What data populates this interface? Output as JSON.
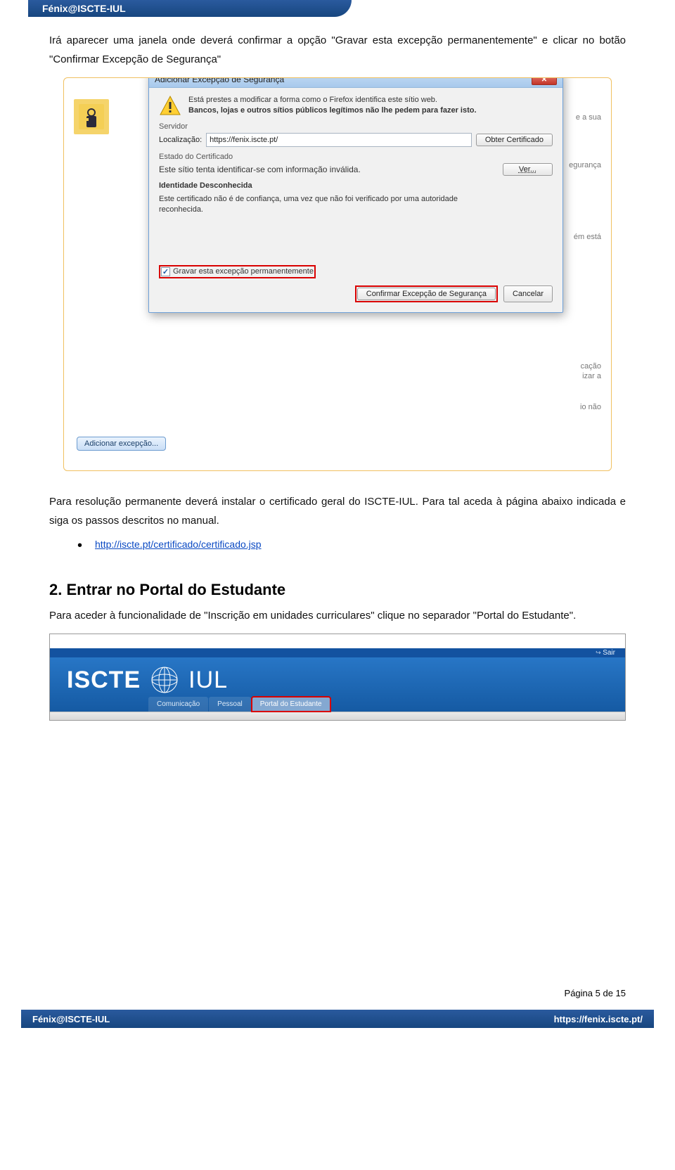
{
  "header": {
    "title": "Fénix@ISCTE-IUL"
  },
  "intro": {
    "p1": "Irá aparecer uma janela onde deverá confirmar a opção \"Gravar esta excepção permanentemente\" e clicar no botão \"Confirmar Excepção de Segurança\""
  },
  "dialog": {
    "title": "Adicionar Excepção de Segurança",
    "alert_line1": "Está prestes a modificar a forma como o Firefox identifica este sítio web.",
    "alert_line2": "Bancos, lojas e outros sítios públicos legítimos não lhe pedem para fazer isto.",
    "server_section": "Servidor",
    "location_label": "Localização:",
    "location_value": "https://fenix.iscte.pt/",
    "get_cert_button": "Obter Certificado",
    "cert_state_section": "Estado do Certificado",
    "cert_state_text": "Este sítio tenta identificar-se com informação inválida.",
    "ver_button": "Ver...",
    "identity_title": "Identidade Desconhecida",
    "identity_text": "Este certificado não é de confiança, uma vez que não foi verificado por uma autoridade reconhecida.",
    "save_checkbox": "Gravar esta excepção permanentemente",
    "confirm_button": "Confirmar Excepção de Segurança",
    "cancel_button": "Cancelar",
    "add_exception_button": "Adicionar excepção..."
  },
  "bg_words": {
    "w1": "e a sua",
    "w2": "egurança",
    "w3": "ém está",
    "w4": "cação",
    "w5": "izar a",
    "w6": "io não"
  },
  "para2": {
    "text": "Para resolução permanente deverá instalar o certificado geral do ISCTE-IUL. Para tal aceda à página abaixo indicada e siga os passos descritos no manual.",
    "link": "http://iscte.pt/certificado/certificado.jsp"
  },
  "section2": {
    "heading": "2. Entrar no Portal do Estudante",
    "text": "Para aceder à funcionalidade de \"Inscrição em unidades curriculares\" clique no separador \"Portal do Estudante\"."
  },
  "banner": {
    "sair": "Sair",
    "logo_a": "ISCTE",
    "logo_b": "IUL",
    "tab1": "Comunicação",
    "tab2": "Pessoal",
    "tab3": "Portal do Estudante"
  },
  "footer": {
    "page": "Página 5 de 15",
    "left": "Fénix@ISCTE-IUL",
    "right": "https://fenix.iscte.pt/"
  }
}
